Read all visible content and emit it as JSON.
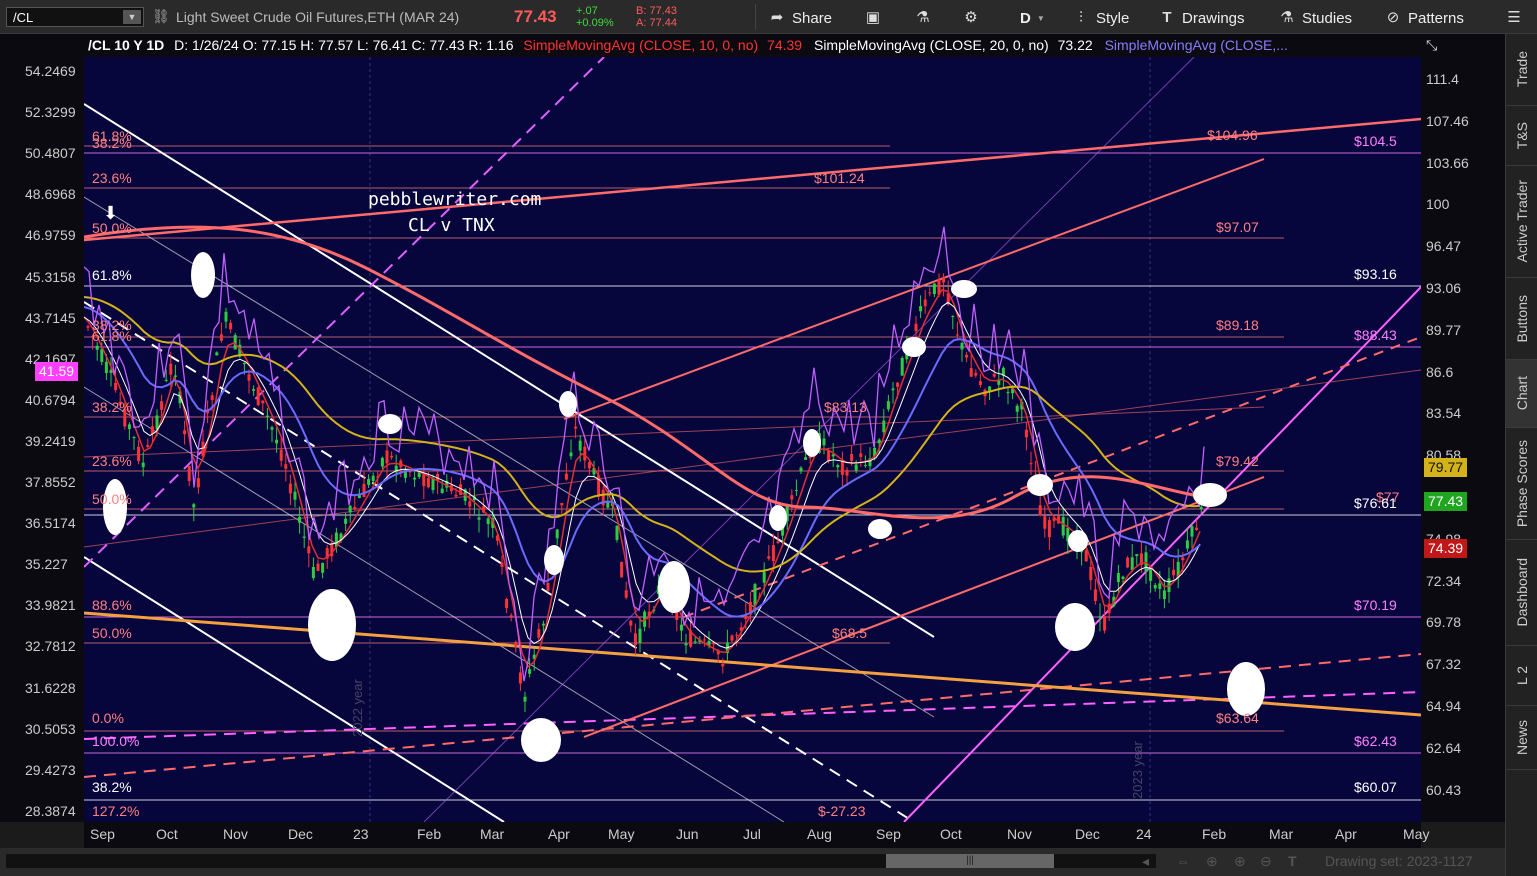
{
  "toolbar": {
    "symbol": "/CL",
    "description": "Light Sweet Crude Oil Futures,ETH (MAR 24)",
    "last": "77.43",
    "change": "+.07",
    "change_pct": "+0.09%",
    "bid": "B: 77.43",
    "ask": "A: 77.44",
    "share_label": "Share",
    "period_label": "D",
    "style_label": "Style",
    "drawings_label": "Drawings",
    "studies_label": "Studies",
    "patterns_label": "Patterns"
  },
  "header": {
    "symbol_period": "/CL 10 Y 1D",
    "ohlc": "D: 1/26/24  O: 77.15  H: 77.57  L: 76.41  C: 77.43  R: 1.16",
    "sma10": "SimpleMovingAvg (CLOSE, 10, 0, no)",
    "sma10_val": "74.39",
    "sma20": "SimpleMovingAvg (CLOSE, 20, 0, no)",
    "sma20_val": "73.22",
    "sma_other": "SimpleMovingAvg (CLOSE,..."
  },
  "left_axis": [
    "54.2469",
    "52.3299",
    "50.4807",
    "48.6968",
    "46.9759",
    "45.3158",
    "43.7145",
    "42.1697",
    "40.6794",
    "39.2419",
    "37.8552",
    "36.5174",
    "35.227",
    "33.9821",
    "32.7812",
    "31.6228",
    "30.5053",
    "29.4273",
    "28.3874"
  ],
  "left_tag": "41.59",
  "right_axis": [
    "111.4",
    "107.46",
    "103.66",
    "100",
    "96.47",
    "93.06",
    "89.77",
    "86.6",
    "83.54",
    "80.58",
    "77.73",
    "74.98",
    "72.34",
    "69.78",
    "67.32",
    "64.94",
    "62.64",
    "60.43"
  ],
  "right_tags": {
    "sma_yellow": "79.77",
    "last_price": "77.43",
    "sma_red": "74.39"
  },
  "x_axis": [
    "Sep",
    "Oct",
    "Nov",
    "Dec",
    "23",
    "Feb",
    "Mar",
    "Apr",
    "May",
    "Jun",
    "Jul",
    "Aug",
    "Sep",
    "Oct",
    "Nov",
    "Dec",
    "24",
    "Feb",
    "Mar",
    "Apr",
    "May"
  ],
  "watermarks": [
    "2022 year",
    "2023 year"
  ],
  "annotation": {
    "line1": "pebblewriter.com",
    "line2": "CL v TNX"
  },
  "fib_labels_left": [
    "61.8%",
    "38.2%",
    "23.6%",
    "50.0%",
    "61.8%",
    "38.2%",
    "61.8%",
    "38.2%",
    "23.6%",
    "50.0%",
    "88.6%",
    "50.0%",
    "0.0%",
    "100.0%",
    "38.2%",
    "127.2%"
  ],
  "level_labels": [
    "$104.96",
    "$104.5",
    "$101.24",
    "$97.07",
    "$93.16",
    "$89.18",
    "$88.43",
    "$83.13",
    "$79.42",
    "$77",
    "$76.61",
    "$70.19",
    "$68.5",
    "$63.64",
    "$62.43",
    "$60.07",
    "$-27.23"
  ],
  "sidebar_tabs": [
    "Trade",
    "T&S",
    "Active Trader",
    "Buttons",
    "Chart",
    "Phase Scores",
    "Dashboard",
    "L 2",
    "News"
  ],
  "drawing_set": "Drawing set: 2023-1127",
  "colors": {
    "chart_bg": "#06063c",
    "sma10": "#e23030",
    "sma20": "#ffffff",
    "sma_blue": "#6a6aff",
    "sma_yellow": "#d4b21a",
    "sma_red": "#ff6a6a",
    "tnx": "#c060ff",
    "up": "#2ecc40",
    "down": "#ff3333"
  }
}
